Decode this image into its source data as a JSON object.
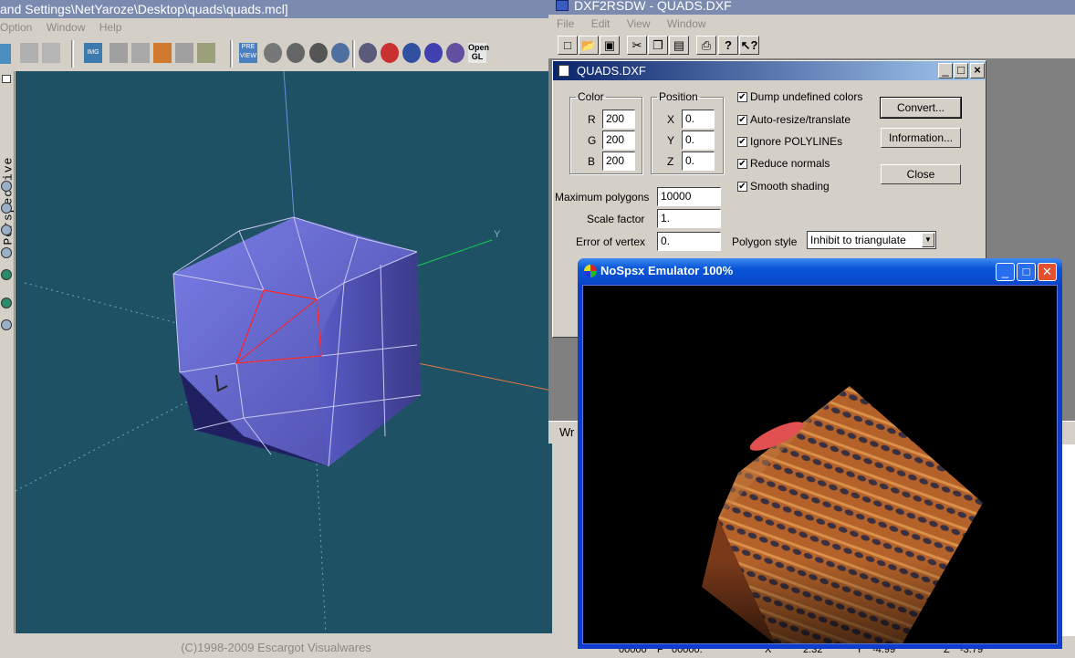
{
  "modeler": {
    "title": "and Settings\\NetYaroze\\Desktop\\quads\\quads.mcl]",
    "menu": [
      "Option",
      "Window",
      "Help"
    ],
    "side_label": "Perspective",
    "axis_label": "Y",
    "status": "(C)1998-2009 Escargot Visualwares"
  },
  "dxf": {
    "title": "DXF2RSDW - QUADS.DXF",
    "menu": [
      "File",
      "Edit",
      "View",
      "Window"
    ],
    "toolbar": [
      "new-icon",
      "open-icon",
      "save-icon",
      "cut-icon",
      "copy-icon",
      "paste-icon",
      "print-icon",
      "help-icon",
      "context-help-icon"
    ],
    "bottom_text": "Wr",
    "dialog": {
      "title": "QUADS.DXF",
      "color": {
        "legend": "Color",
        "r_label": "R",
        "g_label": "G",
        "b_label": "B",
        "r": "200",
        "g": "200",
        "b": "200"
      },
      "position": {
        "legend": "Position",
        "x_label": "X",
        "y_label": "Y",
        "z_label": "Z",
        "x": "0.",
        "y": "0.",
        "z": "0."
      },
      "checks": [
        {
          "label": "Dump undefined colors",
          "checked": true
        },
        {
          "label": "Auto-resize/translate",
          "checked": true
        },
        {
          "label": "Ignore POLYLINEs",
          "checked": true
        },
        {
          "label": "Reduce normals",
          "checked": true
        },
        {
          "label": "Smooth shading",
          "checked": true
        }
      ],
      "max_polygons_label": "Maximum polygons",
      "max_polygons": "10000",
      "scale_label": "Scale factor",
      "scale": "1.",
      "error_label": "Error of vertex",
      "error": "0.",
      "style_label": "Polygon style",
      "style_value": "Inhibit to triangulate",
      "convert_btn": "Convert...",
      "info_btn": "Information...",
      "close_btn": "Close"
    }
  },
  "emulator": {
    "title": "NoSpsx Emulator 100%"
  },
  "bottom_strip": [
    "00000",
    "P",
    "00000.",
    "X",
    "2.32",
    "Y",
    "-4.99",
    "Z",
    "-3.79"
  ]
}
